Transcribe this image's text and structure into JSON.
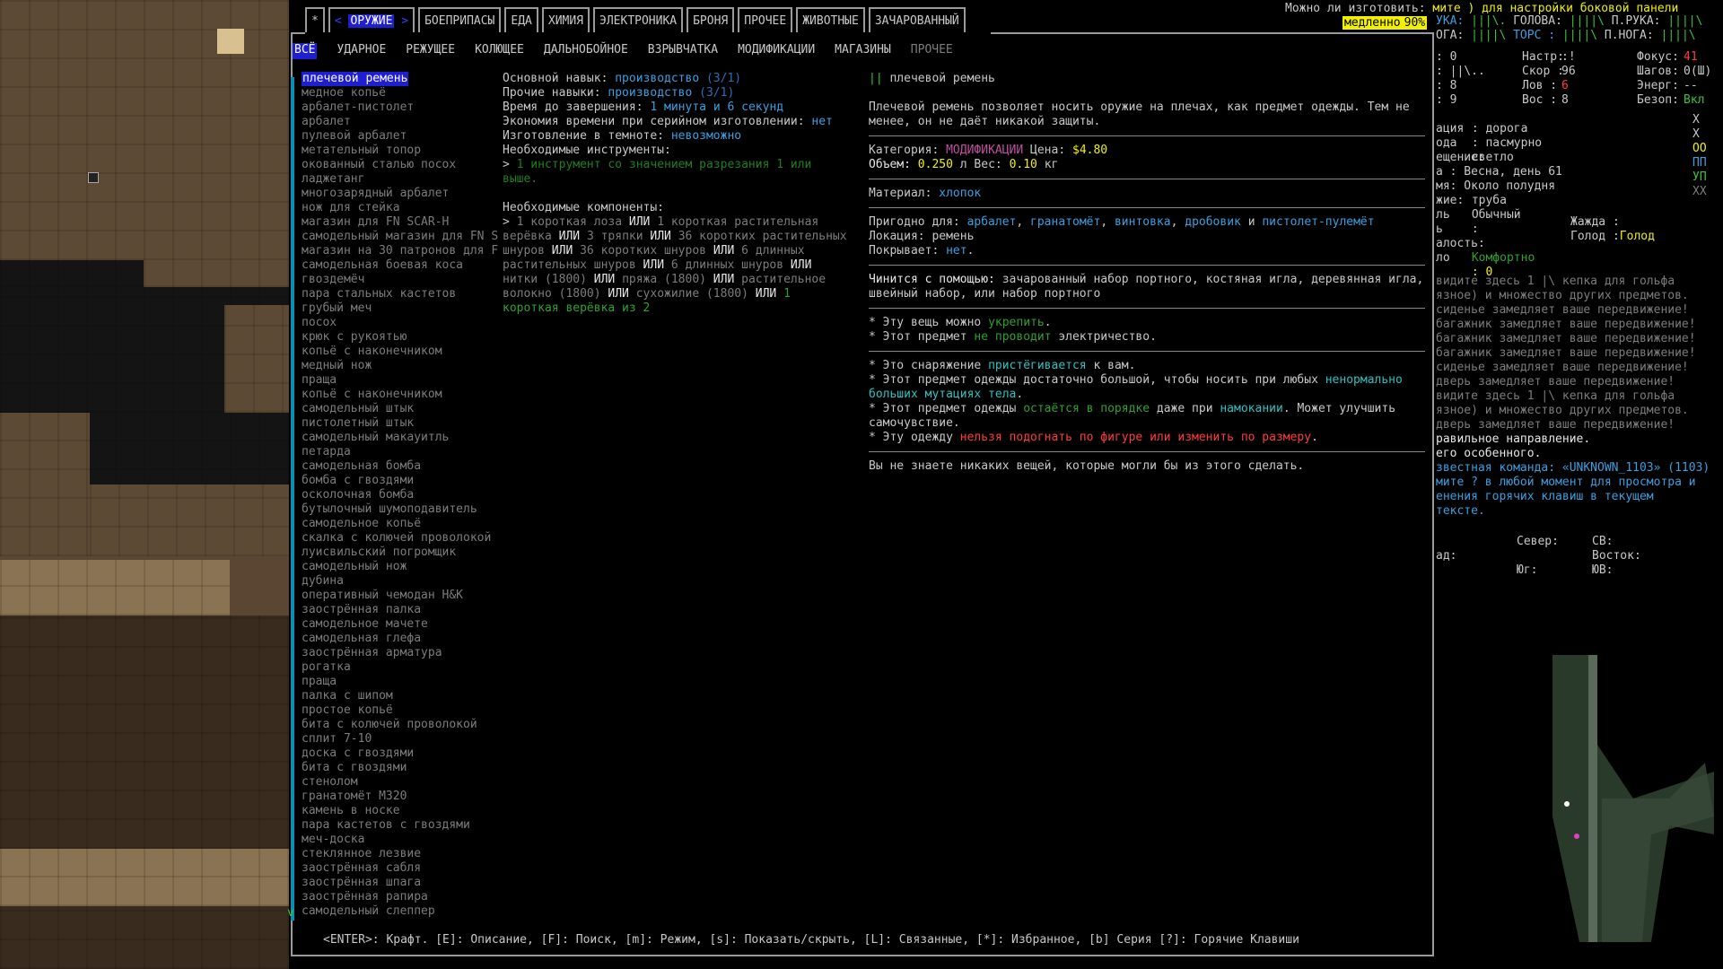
{
  "top_message": {
    "prefix": "Можно ли изготовить:",
    "hint1": "мите ) для настройки боковой панели",
    "speed": "медленно",
    "speed_pct": "90%"
  },
  "tabs": [
    {
      "label": "*",
      "selected": false
    },
    {
      "label": "ОРУЖИЕ",
      "selected": true
    },
    {
      "label": "БОЕПРИПАСЫ"
    },
    {
      "label": "ЕДА"
    },
    {
      "label": "ХИМИЯ"
    },
    {
      "label": "ЭЛЕКТРОНИКА"
    },
    {
      "label": "БРОНЯ"
    },
    {
      "label": "ПРОЧЕЕ"
    },
    {
      "label": "ЖИВОТНЫЕ"
    },
    {
      "label": "ЗАЧАРОВАННЫЙ"
    }
  ],
  "subtabs": [
    {
      "label": "ВСЁ",
      "selected": true
    },
    {
      "label": "УДАРНОЕ"
    },
    {
      "label": "РЕЖУЩЕЕ"
    },
    {
      "label": "КОЛЮЩЕЕ"
    },
    {
      "label": "ДАЛЬНОБОЙНОЕ"
    },
    {
      "label": "ВЗРЫВЧАТКА"
    },
    {
      "label": "МОДИФИКАЦИИ"
    },
    {
      "label": "МАГАЗИНЫ"
    },
    {
      "label": "ПРОЧЕЕ",
      "dim": true
    }
  ],
  "recipes": [
    "плечевой ремень",
    "медное копьё",
    "арбалет-пистолет",
    "арбалет",
    "пулевой арбалет",
    "метательный топор",
    "окованный сталью посох",
    "ладжетанг",
    "многозарядный арбалет",
    "нож для стейка",
    "магазин для FN SCAR-H",
    "самодельный магазин для FN S",
    "магазин на 30 патронов для F",
    "самодельная боевая коса",
    "гвоздемёч",
    "пара стальных кастетов",
    "грубый меч",
    "посох",
    "крюк с рукоятью",
    "копьё с наконечником",
    "медный нож",
    "праща",
    "копьё с наконечником",
    "самодельный штык",
    "пистолетный штык",
    "самодельный макауитль",
    "петарда",
    "самодельная бомба",
    "бомба с гвоздями",
    "осколочная бомба",
    "бутылочный шумоподавитель",
    "самодельное копьё",
    "скалка с колючей проволокой",
    "луисвильский погромщик",
    "самодельный нож",
    "дубина",
    "оперативный чемодан H&K",
    "заострённая палка",
    "самодельное мачете",
    "самодельная глефа",
    "заострённая арматура",
    "рогатка",
    "праща",
    "палка с шипом",
    "простое копьё",
    "бита с колючей проволокой",
    "сплит 7-10",
    "доска с гвоздями",
    "бита с гвоздями",
    "стенолом",
    "гранатомёт M320",
    "камень в носке",
    "пара кастетов с гвоздями",
    "меч-доска",
    "стеклянное лезвие",
    "заострённая сабля",
    "заострённая шпага",
    "заострённая рапира",
    "самодельный слеппер"
  ],
  "scroll_mark": "v",
  "details": {
    "primary_skill_label": "Основной навык:",
    "primary_skill": "производство",
    "primary_skill_lvl": "(3/1)",
    "other_skills_label": "Прочие навыки:",
    "other_skills": "производство",
    "other_skills_lvl": "(3/1)",
    "time_label": "Время до завершения:",
    "time_n1": "1",
    "time_u1": "минута и",
    "time_n2": "6",
    "time_u2": "секунд",
    "batch_label": "Экономия времени при серийном изготовлении:",
    "batch": "нет",
    "dark_label": "Изготовление в темноте:",
    "dark": "невозможно",
    "tools_label": "Необходимые инструменты:",
    "tools_text": "1 инструмент со значением разрезания 1 или выше.",
    "comp_label": "Необходимые компоненты:",
    "comp_text": [
      {
        "t": "1 короткая лоза",
        "c": "dg"
      },
      {
        "t": " ИЛИ ",
        "c": "bold"
      },
      {
        "t": "1 короткая растительная верёвка",
        "c": "dg"
      },
      {
        "t": " ИЛИ ",
        "c": "bold"
      },
      {
        "t": "3 тряпки",
        "c": "dg"
      },
      {
        "t": " ИЛИ ",
        "c": "bold"
      },
      {
        "t": "36 коротких растительных шнуров",
        "c": "dg"
      },
      {
        "t": " ИЛИ ",
        "c": "bold"
      },
      {
        "t": "36 коротких шнуров",
        "c": "dg"
      },
      {
        "t": " ИЛИ ",
        "c": "bold"
      },
      {
        "t": "6 длинных растительных шнуров",
        "c": "dg"
      },
      {
        "t": " ИЛИ ",
        "c": "bold"
      },
      {
        "t": "6 длинных шнуров",
        "c": "dg"
      },
      {
        "t": " ИЛИ ",
        "c": "bold"
      },
      {
        "t": "нитки (1800)",
        "c": "dg"
      },
      {
        "t": " ИЛИ ",
        "c": "bold"
      },
      {
        "t": "пряжа (1800)",
        "c": "dg"
      },
      {
        "t": " ИЛИ ",
        "c": "bold"
      },
      {
        "t": "растительное волокно (1800)",
        "c": "dg"
      },
      {
        "t": " ИЛИ ",
        "c": "bold"
      },
      {
        "t": "сухожилие (1800)",
        "c": "dg"
      },
      {
        "t": " ИЛИ ",
        "c": "bold"
      },
      {
        "t": "1 короткая верёвка из 2",
        "c": "gr2"
      }
    ]
  },
  "item": {
    "symbol": "||",
    "name": "плечевой ремень",
    "desc": "Плечевой ремень позволяет носить оружие на плечах, как предмет одежды. Тем не менее, он не даёт никакой защиты.",
    "category_label": "Категория:",
    "category": "МОДИФИКАЦИИ",
    "price_label": "Цена:",
    "price": "$4.80",
    "volume_label": "Объем:",
    "volume": "0.250",
    "volume_unit": "л",
    "weight_label": "Вес:",
    "weight": "0.10",
    "weight_unit": "кг",
    "material_label": "Материал:",
    "material": "хлопок",
    "suitable_label": "Пригодно для:",
    "suitable": [
      "арбалет",
      "гранатомёт",
      "винтовка",
      "дробовик",
      "пистолет-пулемёт"
    ],
    "suitable_and": "и",
    "location_label": "Локация:",
    "location": "ремень",
    "covers_label": "Покрывает:",
    "covers": "нет",
    "repair_label": "Чинится с помощью:",
    "repair": "зачарованный набор портного, костяная игла, деревянная игла, швейный набор, или набор портного",
    "notes1": [
      {
        "a": "* Эту вещь можно ",
        "b": "укрепить",
        "c": "."
      },
      {
        "a": "* Этот предмет ",
        "b": "не проводит",
        "c": " электричество."
      }
    ],
    "notes2a": "* Это снаряжение ",
    "notes2b": "пристёгивается",
    "notes2c": " к вам.",
    "notes3a": "* Этот предмет одежды достаточно большой, чтобы носить при любых ",
    "notes3b": "ненормально больших мутациях тела",
    "notes3c": ".",
    "notes4a": "* Этот предмет одежды ",
    "notes4b": "остаётся в порядке",
    "notes4c": " даже при ",
    "notes4d": "намокании",
    "notes4e": ". Может улучшить самочувствие.",
    "notes5a": "* Эту одежду ",
    "notes5b": "нельзя подогнать по фигуре или изменить по размеру",
    "notes5c": ".",
    "unknown": "Вы не знаете никаких вещей, которые могли бы из этого сделать."
  },
  "footer": "<ENTER>: Крафт.  [E]: Описание, [F]: Поиск, [m]: Режим, [s]: Показать/скрыть, [L]: Связанные, [*]: Избранное, [b] Серия [?]: Горячие Клавиши",
  "sidebar": {
    "r1": [
      "УКА:",
      "|||\\.",
      "ГОЛОВА:",
      "||||\\",
      "П.РУКА:",
      "||||\\"
    ],
    "r2": [
      "ОГА:",
      "||||\\",
      "ТОРС :",
      "||||\\",
      "П.НОГА:",
      "||||\\"
    ],
    "stats": [
      [
        ": 0",
        "Настр:",
        ":!",
        "Фокус:",
        "41"
      ],
      [
        ": ||\\..",
        "Скор :",
        "96",
        "Шагов:",
        "0(Ш)"
      ],
      [
        ": 8",
        "Лов :",
        "6",
        "Энерг:",
        "--"
      ],
      [
        ": 9",
        "Вос :",
        "8",
        "Безоп:",
        "Вкл"
      ]
    ],
    "env": [
      [
        "ация",
        ": дорога"
      ],
      [
        "ода",
        ": пасмурно"
      ],
      [
        "ещение:",
        "светло"
      ],
      [
        "а : Весна, день 61",
        ""
      ],
      [
        "мя: Около полудня",
        ""
      ],
      [
        "жие:",
        "труба"
      ],
      [
        "ль",
        "Обычный"
      ],
      [
        "ь",
        ":"
      ],
      [
        "алость:",
        ""
      ],
      [
        "ло",
        "Комфортно"
      ],
      [
        "",
        ": 0"
      ]
    ],
    "thirst": "Жажда :",
    "hunger": "Голод :",
    "hunger_val": "Голод",
    "log": [
      "видите здесь 1 |\\ кепка для гольфа",
      "язное) и множество других предметов.",
      "сиденье замедляет ваше передвижение!",
      "багажник замедляет ваше передвижение!",
      "багажник замедляет ваше передвижение!",
      "багажник замедляет ваше передвижение!",
      "сиденье замедляет ваше передвижение!",
      "дверь замедляет ваше передвижение!",
      "видите здесь 1 |\\ кепка для гольфа",
      "язное) и множество других предметов.",
      "дверь замедляет ваше передвижение!"
    ],
    "log2": [
      "равильное направление.",
      "его особенного."
    ],
    "log3": [
      "звестная команда: «UNKNOWN_1103» (1103)",
      "мите ? в любой момент для просмотра и",
      "енения горячих клавиш в текущем",
      "тексте."
    ],
    "compass": [
      [
        "",
        "Север:",
        "СВ:"
      ],
      [
        "ад:",
        "",
        "Восток:"
      ],
      [
        "",
        "Юг:",
        "ЮВ:"
      ]
    ],
    "glyphs": [
      "Х",
      "Х",
      "ОО",
      "ПП",
      "УП",
      "ХХ"
    ]
  }
}
